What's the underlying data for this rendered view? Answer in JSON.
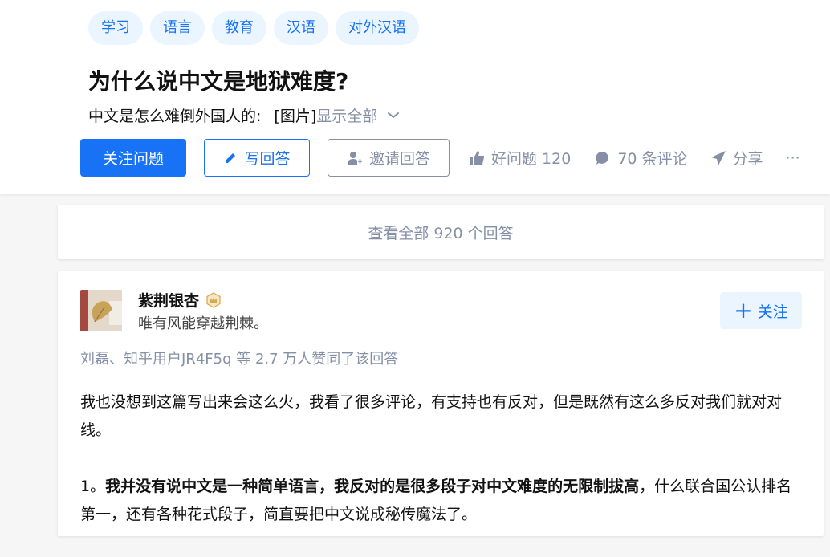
{
  "question": {
    "topics": [
      "学习",
      "语言",
      "教育",
      "汉语",
      "对外汉语"
    ],
    "title": "为什么说中文是地狱难度?",
    "excerpt_text": "中文是怎么难倒外国人的:",
    "excerpt_image": "[图片]",
    "show_all": "显示全部",
    "follow_label": "关注问题",
    "write_label": "写回答",
    "invite_label": "邀请回答",
    "good_question": "好问题 120",
    "comments": "70 条评论",
    "share": "分享",
    "more": "···"
  },
  "view_all": "查看全部 920 个回答",
  "answer": {
    "author_name": "紫荆银杏",
    "author_bio": "唯有风能穿越荆棘。",
    "follow_label": "关注",
    "voters": "刘磊、知乎用户JR4F5q 等 2.7 万人赞同了该回答",
    "para1": "我也没想到这篇写出来会这么火，我看了很多评论，有支持也有反对，但是既然有这么多反对我们就对对线。",
    "para2_prefix": "1。",
    "para2_bold": "我并没有说中文是一种简单语言，我反对的是很多段子对中文难度的无限制拔高",
    "para2_rest": "，什么联合国公认排名第一，还有各种花式段子，简直要把中文说成秘传魔法了。"
  },
  "colors": {
    "brand_blue": "#1772f6",
    "tag_bg": "#ebf5ff",
    "muted": "#8590a6"
  }
}
